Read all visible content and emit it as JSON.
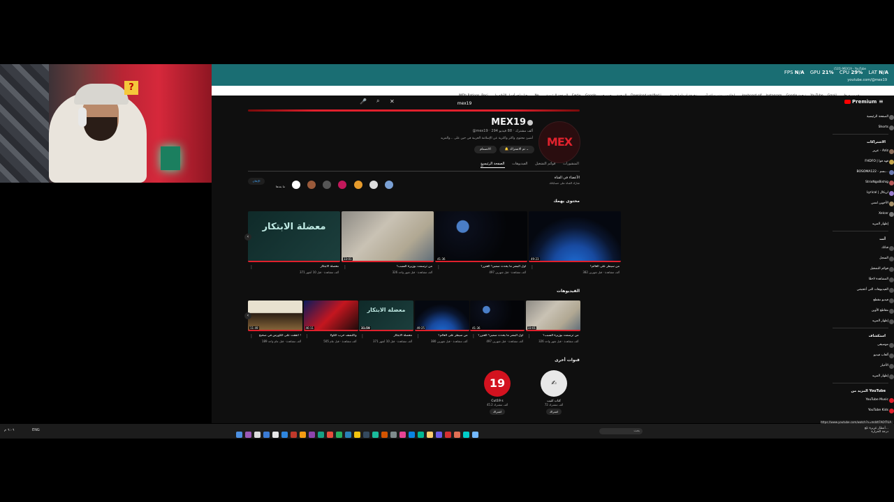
{
  "webcam": {
    "lamp_symbol": "?"
  },
  "browser": {
    "stats": {
      "fps_label": "FPS",
      "fps_value": "N/A",
      "gpu_label": "GPU",
      "gpu_value": "21%",
      "cpu_label": "CPU",
      "cpu_value": "29%",
      "lat_label": "LAT",
      "lat_value": "N/A"
    },
    "tab_title": "(535) MEX19 - YouTube",
    "url": "youtube.com/@mex19",
    "bookmarks": [
      "IMDb Ratings, Reci...",
      "هنا شاهد أفضل الأفلام وا...",
      "Ne...",
      "الصفحة الرئيسية",
      "Fwd+",
      "Google - بحث بحث",
      "الترجمة",
      "Download verified l...",
      "زخرفة اسماء | حروف...",
      "ايقاعيس يوزن ساعد آن...",
      "keyboard gif",
      "Instagram",
      "Google ترجمة",
      "YouTube",
      "Gmail",
      "رقم سري هاتي"
    ]
  },
  "youtube": {
    "search_value": "mex19",
    "premium_label": "Premium",
    "channel": {
      "avatar_text": "MEX",
      "name": "MEX19",
      "handle_line": "@mex19 ‧ 294 ألف مشترك ‧ 88 فيديو",
      "description": "أشيئ محتوى واكثر واكثرية عن الإسلامة العربية في حين على ...والمزيد",
      "subscribe_label": "تم الاشتراك",
      "join_label": "الانضمام",
      "tabs": [
        "الصفحة الرئيسية",
        "الفيديوهات",
        "قوائم التشغيل",
        "المنشورات"
      ]
    },
    "featured": {
      "title": "الأعضاء في القناة",
      "subtitle": "شارك القناة على حساباتك",
      "all_label": "الإعلان",
      "more_label": "ما بعدها"
    },
    "sections": {
      "for_you": "محتوى يهمك",
      "videos": "الفيديوهات",
      "other_channels": "قنوات أخرى"
    },
    "for_you_videos": [
      {
        "title": "من سيطر على العالم؟",
        "meta": "382 ألف مشاهدة ‧ قبل شهرين",
        "duration": "49:23",
        "style": "t-earth"
      },
      {
        "title": "أول البشر ما يحدث سمير؟ العنزر؟",
        "meta": "497 ألف مشاهدة ‧ قبل شهرين",
        "duration": "41:36",
        "style": "t-space"
      },
      {
        "title": "من ترسمت بوزيرة السبب؟",
        "meta": "326 ألف مشاهدة ‧ قبل شهر واحد",
        "duration": "33:01",
        "style": "t-map"
      },
      {
        "title": "معضلة الابتكار",
        "meta": "371 ألف مشاهدة ‧ قبل 10 أشهر",
        "duration": "",
        "style": "t-arabic",
        "overlay": "معضلة الابتكار"
      }
    ],
    "videos": [
      {
        "title": "من ترسمت بوزيرة السبب؟",
        "meta": "326 ألف مشاهدة ‧ قبل شهر واحد",
        "duration": "33:01",
        "style": "t-map"
      },
      {
        "title": "أول البشر ما يحدث سمير؟ العنزر؟",
        "meta": "497 ألف مشاهدة ‧ قبل شهرين",
        "duration": "41:36",
        "style": "t-space"
      },
      {
        "title": "من سيطر على العالم؟",
        "meta": "380 ألف مشاهدة ‧ قبل شهرين",
        "duration": "49:25",
        "style": "t-earth"
      },
      {
        "title": "معضلة الابتكار",
        "meta": "371 ألف مشاهدة ‧ قبل 10 أشهر",
        "duration": "31:59",
        "style": "t-arabic",
        "overlay": "معضلة الابتكار"
      },
      {
        "title": "واكتشف حرب الكولا",
        "meta": "505 ألف مشاهدة ‧ قبل عام",
        "duration": "46:11",
        "style": "t-red"
      },
      {
        "title": "انفقت على الكورس في صحيح !",
        "meta": "189 ألف مشاهدة ‧ قبل عام واحد",
        "duration": "11:49",
        "style": "t-sand"
      }
    ],
    "other_channels": [
      {
        "name": "كتاب كتيب",
        "subs": "72 ألف مشترك",
        "btn": "اشتراك",
        "color": "#e8e8e8"
      },
      {
        "name": "Cut19 s",
        "subs": "45.2 ألف مشترك",
        "btn": "اشتراك",
        "color": "#d3121f",
        "avatar_text": "19"
      }
    ],
    "sidebar": {
      "main": [
        {
          "label": "الصفحة الرئيسية"
        },
        {
          "label": "Shorts"
        }
      ],
      "subs_head": "الاشتراكات",
      "subs": [
        {
          "label": "عزيز - Aziz",
          "color": "#8a6d5a"
        },
        {
          "label": "FHDFO | فهد فوا",
          "color": "#c6a64b"
        },
        {
          "label": "BOSOMA122 - بسم...",
          "color": "#6b7bb3"
        },
        {
          "label": "StrixNgoBishig",
          "color": "#b85a5a"
        },
        {
          "label": "Lyrical | لريكال",
          "color": "#9b7fd1"
        },
        {
          "label": "الأخوين لمس",
          "color": "#a8926b"
        },
        {
          "label": "Xelcer",
          "color": "#7a7a7a"
        },
        {
          "label": "إظهار المزيد",
          "color": "#0f0f0f"
        }
      ],
      "you_head": "أنت",
      "you": [
        {
          "label": "قناتك"
        },
        {
          "label": "السجل"
        },
        {
          "label": "قوائم التشغيل"
        },
        {
          "label": "المشاهدة لاحقًا"
        },
        {
          "label": "الفيديوهات التي أعجبتني"
        },
        {
          "label": "فيديو مقطع"
        },
        {
          "label": "مقاطع الأوين"
        },
        {
          "label": "إظهار المزيد"
        }
      ],
      "explore_head": "استكشاف",
      "explore": [
        {
          "label": "موسيقى"
        },
        {
          "label": "ألعاب فيديو"
        },
        {
          "label": "الأخبار"
        },
        {
          "label": "إظهار المزيد"
        }
      ],
      "more_head": "المزيد من YouTube",
      "more": [
        {
          "label": "YouTube Music"
        },
        {
          "label": "YouTube Kids"
        }
      ]
    },
    "status_url": "https://www.youtube.com/watch?v=mddt7AOf7UA"
  },
  "taskbar": {
    "lang": "ENG",
    "time": "٦:٠٦ م",
    "date": "٢٠٢٥/٠٢/١٧",
    "search_placeholder": "بحث",
    "weather": "أمطار غزيرة تلغ...",
    "weather_sub": "درجة الحرارة"
  }
}
